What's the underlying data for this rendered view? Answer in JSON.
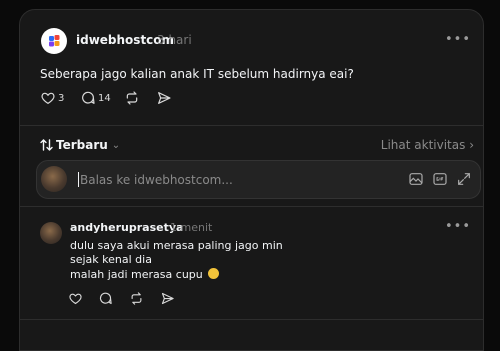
{
  "post": {
    "username": "idwebhostcom",
    "timestamp": "3 hari",
    "text": "Seberapa jago kalian anak IT sebelum hadirnya eai?",
    "like_count": "3",
    "comment_count": "14",
    "icons": {
      "like": "heart-icon",
      "comment": "comment-icon",
      "repost": "repost-icon",
      "share": "send-icon",
      "more": "more-icon"
    }
  },
  "sort": {
    "label": "Terbaru",
    "icon": "sort-icon"
  },
  "activity_link": "Lihat aktivitas",
  "activity_chevron": "›",
  "reply_box": {
    "placeholder": "Balas ke idwebhostcom..."
  },
  "comment": {
    "username": "andyheruprasetya",
    "timestamp": "1 menit",
    "lines": [
      "dulu saya akui merasa paling jago min",
      "sejak kenal dia",
      "malah jadi merasa cupu"
    ],
    "emoji": "grinning-face"
  },
  "colors": {
    "background": "#0a0a0a",
    "panel": "#181818",
    "text": "#f3f5f7",
    "muted": "#777777"
  }
}
